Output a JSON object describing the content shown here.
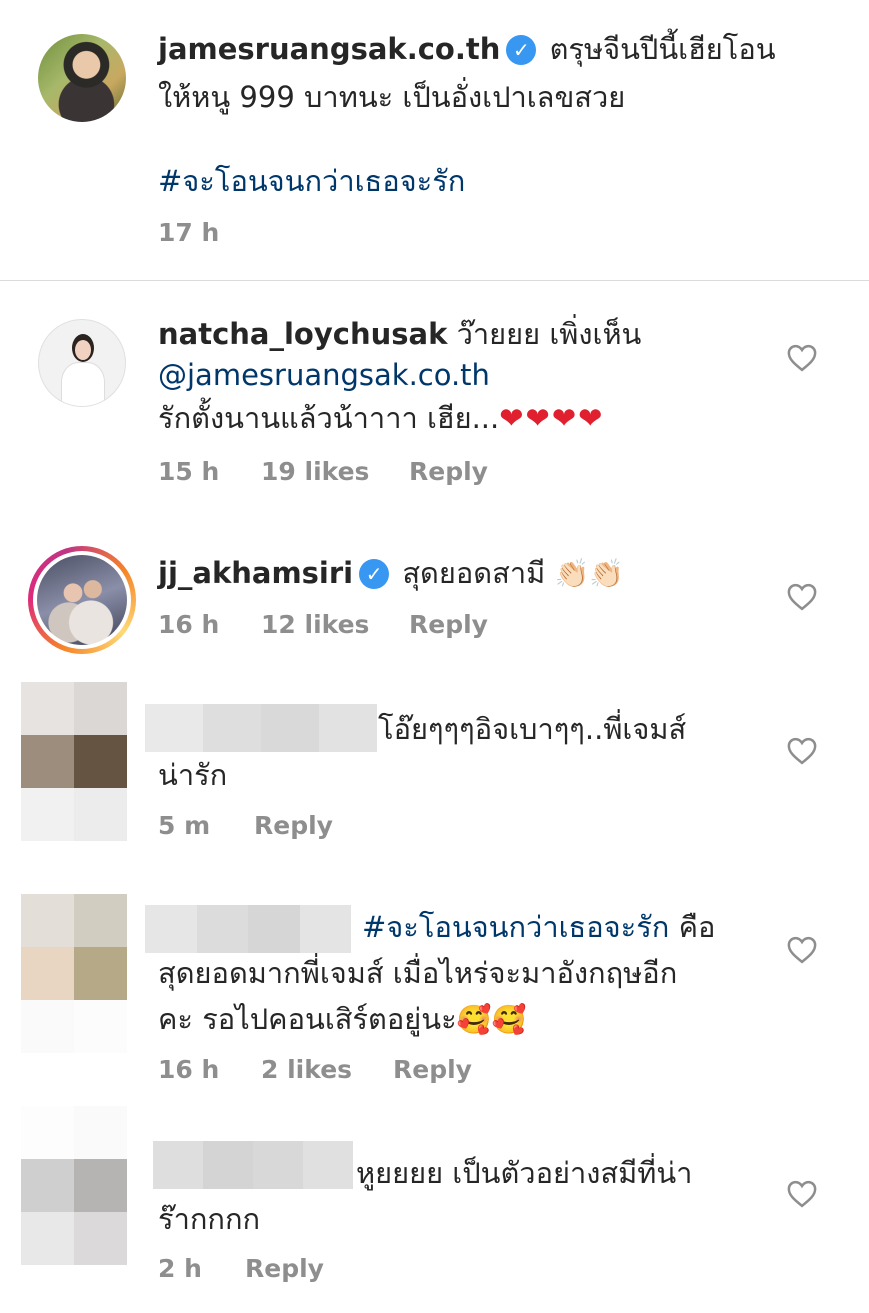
{
  "caption": {
    "username": "jamesruangsak.co.th",
    "text_line1": "ตรุษจีนปีนี้เฮียโอน",
    "text_line2": "ให้หนู 999 บาทนะ เป็นอั่งเปาเลขสวย",
    "hashtag": "#จะโอนจนกว่าเธอจะรัก",
    "time": "17 h"
  },
  "comments": [
    {
      "username": "natcha_loychusak",
      "text_line1": "ว๊ายยย เพิ่งเห็น",
      "mention": "@jamesruangsak.co.th",
      "text_line3": "รักตั้งนานแล้วน้าาาา เฮีย...",
      "emoji": "❤❤❤❤",
      "time": "15 h",
      "likes": "19 likes",
      "reply": "Reply"
    },
    {
      "username": "jj_akhamsiri",
      "text_line1": "สุดยอดสามี",
      "emoji": "👏🏻👏🏻",
      "time": "16 h",
      "likes": "12 likes",
      "reply": "Reply"
    },
    {
      "text_line1": "โอ๊ยๆๆๆอิจเบาๆๆ..พี่เจมส์",
      "text_line2": "น่ารัก",
      "time": "5 m",
      "reply": "Reply"
    },
    {
      "hashtag": "#จะโอนจนกว่าเธอจะรัก",
      "text_line1_suffix": "คือ",
      "text_line2": "สุดยอดมากพี่เจมส์ เมื่อไหร่จะมาอังกฤษอีก",
      "text_line3": "คะ รอไปคอนเสิร์ตอยู่นะ",
      "emoji": "🥰🥰",
      "time": "16 h",
      "likes": "2 likes",
      "reply": "Reply"
    },
    {
      "text_line1": "หูยยยย เป็นตัวอย่างสมีที่น่า",
      "text_line2": "ร๊ากกกก",
      "time": "2 h",
      "reply": "Reply"
    }
  ],
  "verified_glyph": "✓",
  "heart_icon": "heart-outline-icon",
  "colors": {
    "link": "#00376b",
    "meta": "#8e8e8e",
    "verified": "#3897f0",
    "divider": "#dbdbdb"
  }
}
